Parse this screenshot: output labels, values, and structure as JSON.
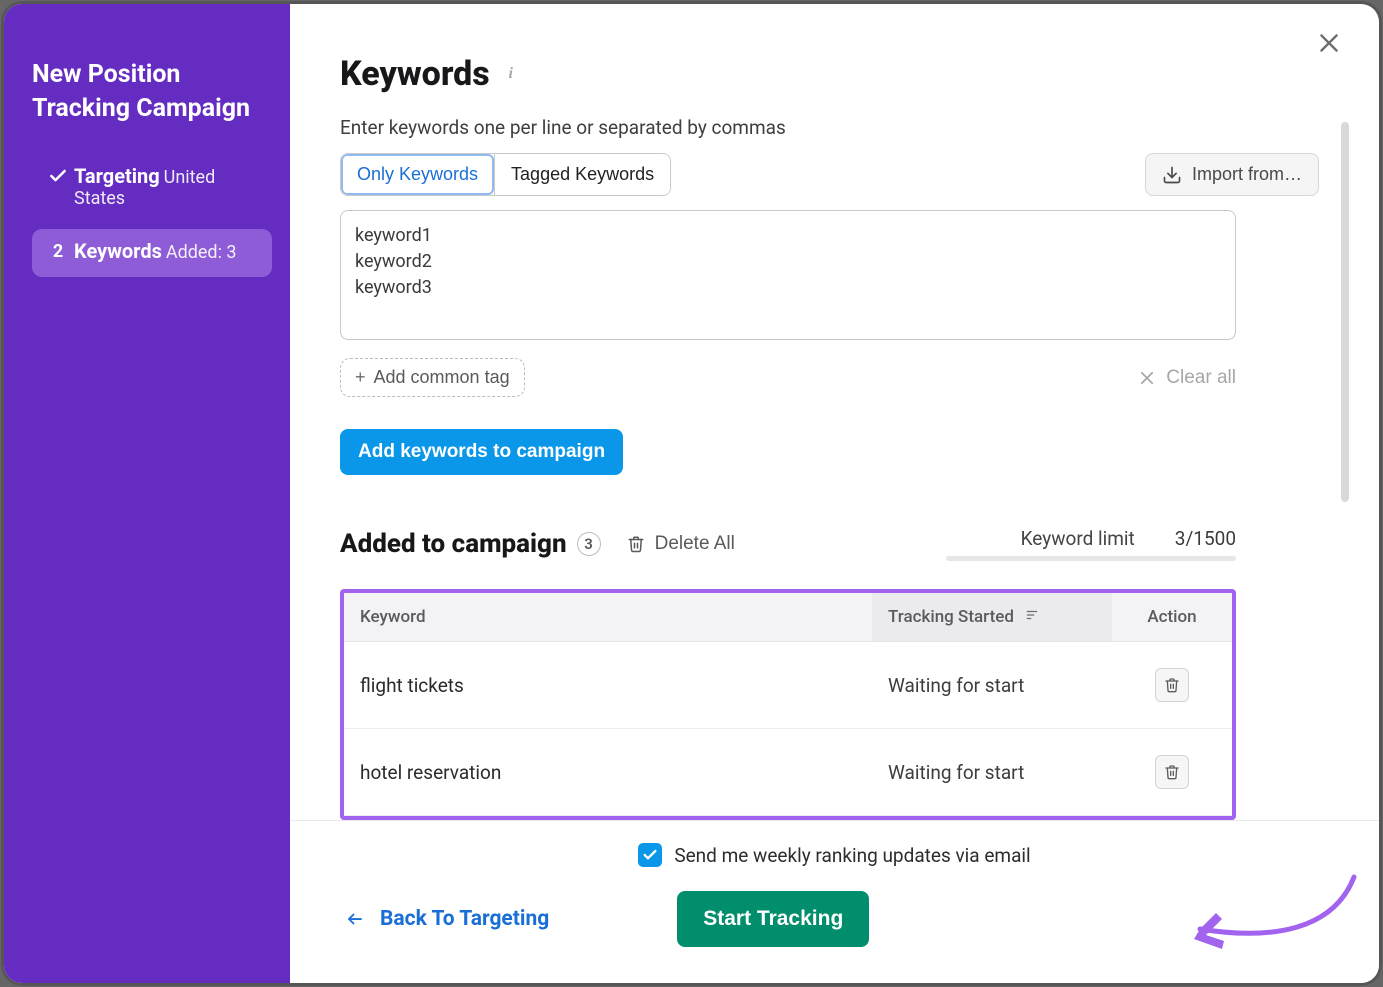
{
  "sidebar": {
    "title": "New Position Tracking Campaign",
    "steps": [
      {
        "label": "Targeting",
        "sub": "United States",
        "completed": true
      },
      {
        "label": "Keywords",
        "sub": "Added: 3",
        "number": "2",
        "active": true
      }
    ]
  },
  "header": {
    "title": "Keywords",
    "helper": "Enter keywords one per line or separated by commas"
  },
  "tabs": {
    "only": "Only Keywords",
    "tagged": "Tagged Keywords"
  },
  "import_label": "Import from…",
  "textarea_value": "keyword1\nkeyword2\nkeyword3",
  "add_tag_label": "Add common tag",
  "clear_all_label": "Clear all",
  "add_button": "Add keywords to campaign",
  "added": {
    "title": "Added to campaign",
    "count": "3",
    "delete_all": "Delete All",
    "limit_label": "Keyword limit",
    "limit_value": "3/1500"
  },
  "table": {
    "columns": {
      "keyword": "Keyword",
      "tracking": "Tracking Started",
      "action": "Action"
    },
    "rows": [
      {
        "keyword": "flight tickets",
        "tracking": "Waiting for start"
      },
      {
        "keyword": "hotel reservation",
        "tracking": "Waiting for start"
      }
    ]
  },
  "footer": {
    "weekly": "Send me weekly ranking updates via email",
    "back": "Back To Targeting",
    "start": "Start Tracking"
  }
}
